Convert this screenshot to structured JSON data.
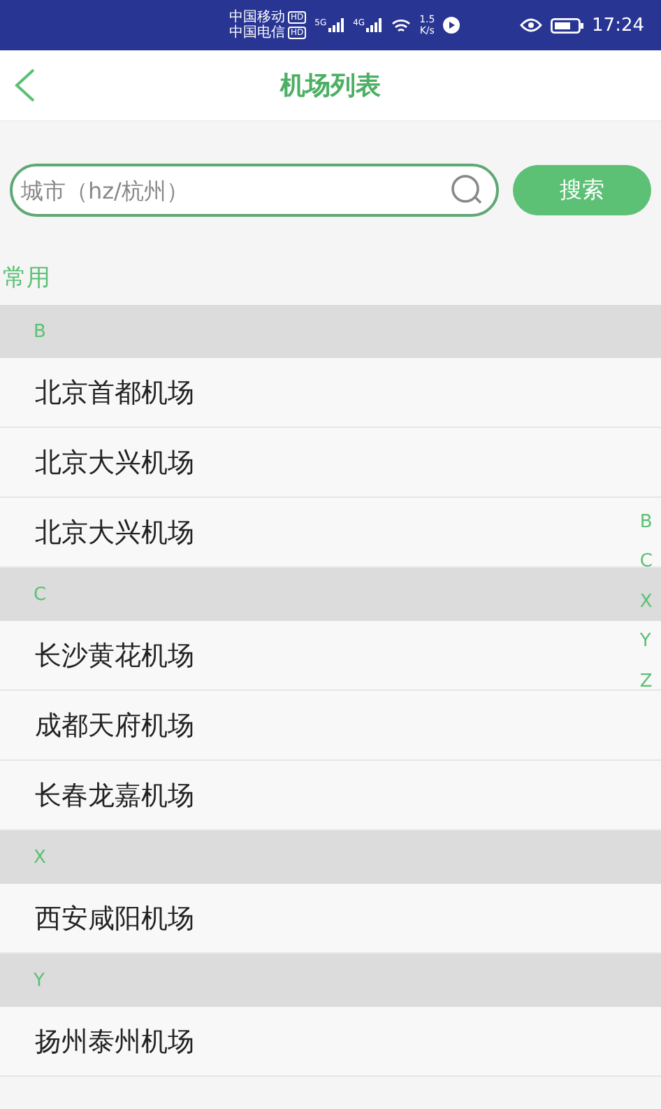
{
  "status_bar": {
    "carriers": [
      {
        "name": "中国移动",
        "badge": "HD"
      },
      {
        "name": "中国电信",
        "badge": "HD"
      }
    ],
    "networks": [
      {
        "label": "5G"
      },
      {
        "label": "4G"
      }
    ],
    "speed": "1.5",
    "speed_unit": "K/s",
    "time": "17:24"
  },
  "header": {
    "title": "机场列表"
  },
  "search": {
    "placeholder": "城市（hz/杭州）",
    "button": "搜索"
  },
  "common_label": "常用",
  "sections": [
    {
      "letter": "B",
      "airports": [
        "北京首都机场",
        "北京大兴机场",
        "北京大兴机场"
      ]
    },
    {
      "letter": "C",
      "airports": [
        "长沙黄花机场",
        "成都天府机场",
        "长春龙嘉机场"
      ]
    },
    {
      "letter": "X",
      "airports": [
        "西安咸阳机场"
      ]
    },
    {
      "letter": "Y",
      "airports": [
        "扬州泰州机场"
      ]
    }
  ],
  "index_letters": [
    "B",
    "C",
    "X",
    "Y",
    "Z"
  ]
}
